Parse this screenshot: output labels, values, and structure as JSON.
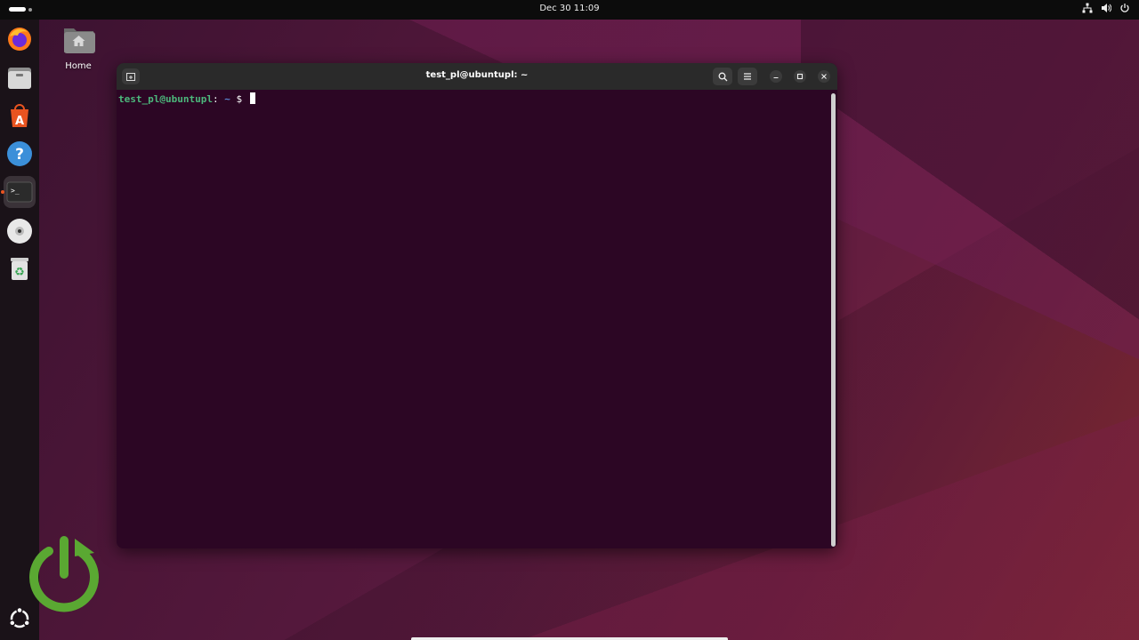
{
  "topbar": {
    "clock": "Dec 30  11:09",
    "tray_icons": [
      "network-icon",
      "volume-icon",
      "power-icon"
    ]
  },
  "dock": {
    "items": [
      {
        "name": "firefox",
        "icon": "firefox-icon"
      },
      {
        "name": "files",
        "icon": "files-icon"
      },
      {
        "name": "app-center",
        "icon": "app-center-icon"
      },
      {
        "name": "help",
        "icon": "help-icon",
        "glyph": "?"
      },
      {
        "name": "terminal",
        "icon": "terminal-icon",
        "glyph": ">_",
        "active": true
      },
      {
        "name": "disc",
        "icon": "disc-icon"
      },
      {
        "name": "trash",
        "icon": "trash-icon",
        "glyph": "♻"
      },
      {
        "name": "show-apps",
        "icon": "ubuntu-logo-icon"
      }
    ]
  },
  "desktop": {
    "home_label": "Home"
  },
  "terminal": {
    "title": "test_pl@ubuntupl: ~",
    "prompt_user": "test_pl@ubuntupl",
    "prompt_sep": ":",
    "prompt_path": "~",
    "prompt_symbol": "$"
  },
  "colors": {
    "accent": "#e95420",
    "terminal_bg": "#2c0624",
    "prompt_user": "#4cb87c",
    "prompt_path": "#5b8ad6",
    "power_logo": "#5aa832"
  }
}
